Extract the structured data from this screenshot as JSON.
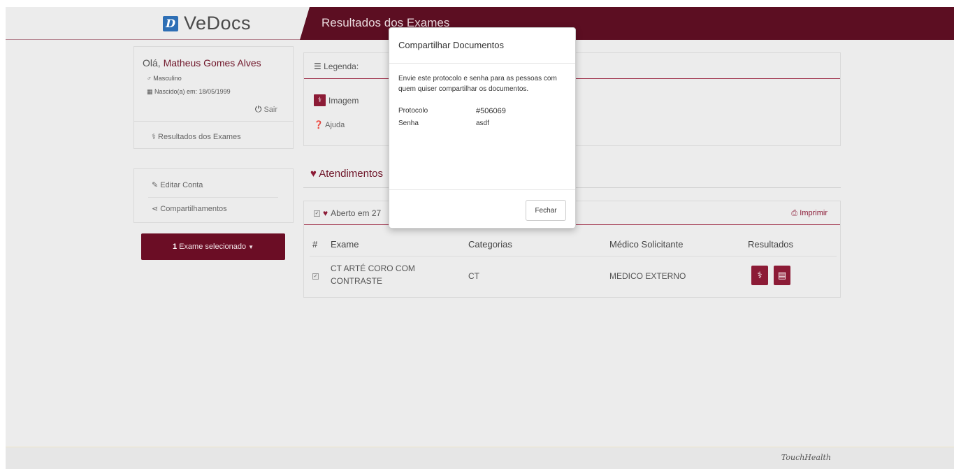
{
  "colors": {
    "brand": "#5c0e22",
    "accent": "#8c1b36",
    "logo": "#2e6fb5"
  },
  "header": {
    "brand": "VeDocs",
    "title": "Resultados dos Exames"
  },
  "user": {
    "greeting": "Olá,",
    "name": "Matheus Gomes Alves",
    "gender_icon": "male-icon",
    "gender": "Masculino",
    "birth_icon": "calendar-icon",
    "birth": "Nascido(a) em: 18/05/1999",
    "logout": "Sair",
    "results_link": "Resultados dos Exames"
  },
  "menu": {
    "edit_account": "Editar Conta",
    "shares": "Compartilhamentos"
  },
  "exam_button": {
    "count": "1",
    "label": "Exame selecionado"
  },
  "legend": {
    "title": "Legenda:",
    "image": "Imagem",
    "help": "Ajuda"
  },
  "attendances": {
    "title": "Atendimentos"
  },
  "results": {
    "open_label": "Aberto em 27",
    "print": "Imprimir",
    "columns": {
      "hash": "#",
      "exam": "Exame",
      "category": "Categorias",
      "doctor": "Médico Solicitante",
      "results": "Resultados"
    },
    "rows": [
      {
        "exam": "CT ARTÉ CORO COM CONTRASTE",
        "category": "CT",
        "doctor": "MEDICO EXTERNO"
      }
    ]
  },
  "modal": {
    "title": "Compartilhar Documentos",
    "text": "Envie este protocolo e senha para as pessoas com quem quiser compartilhar os documentos.",
    "protocol_label": "Protocolo",
    "protocol_value": "#506069",
    "password_label": "Senha",
    "password_value": "asdf",
    "close": "Fechar"
  },
  "footer": {
    "brand": "TouchHealth"
  }
}
